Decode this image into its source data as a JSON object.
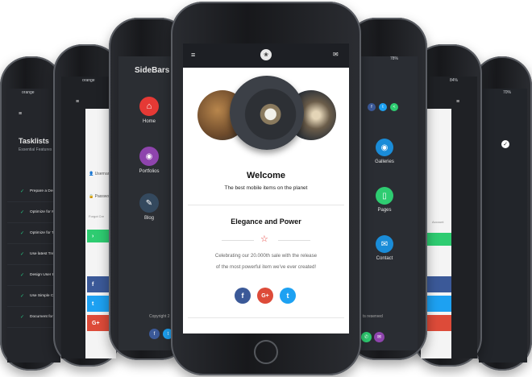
{
  "phone_far_left": {
    "carrier": "orange",
    "title": "Tasklists",
    "subtitle": "Essential Features Sh",
    "tasks": [
      "Prepare a Design",
      "Optimize for Mo",
      "Optimize for Ta",
      "Use latest Trend",
      "Design User Exp",
      "Use Simple Cod",
      "Document for El"
    ]
  },
  "phone_left2": {
    "carrier": "orange",
    "fields": [
      "Usernar",
      "Passwo",
      "Forgot Cre"
    ],
    "go_label": "›",
    "social": [
      "f",
      "t",
      "G+"
    ]
  },
  "phone_left1": {
    "title": "SideBars",
    "nav": [
      {
        "label": "Home",
        "icon": "home-icon",
        "color": "#e53935"
      },
      {
        "label": "Portfolios",
        "icon": "camera-icon",
        "color": "#8e44ad"
      },
      {
        "label": "Blog",
        "icon": "pencil-icon",
        "color": "#34495e"
      }
    ],
    "copyright": "Copyright 2",
    "social": [
      "f",
      "t"
    ]
  },
  "phone_center": {
    "menu_icon": "hamburger-icon",
    "logo_icon": "logo-icon",
    "mail_icon": "mail-icon",
    "welcome_title": "Welcome",
    "welcome_subtitle": "The best mobile items on the planet",
    "section_title": "Elegance and Power",
    "star_icon": "star-icon",
    "body_line1": "Celebrating our 20.000th sale with the release",
    "body_line2": "of the most powerful item we've ever created!",
    "social": [
      {
        "label": "f",
        "icon": "facebook-icon",
        "color": "#3b5998"
      },
      {
        "label": "G+",
        "icon": "google-plus-icon",
        "color": "#dd4b39"
      },
      {
        "label": "t",
        "icon": "twitter-icon",
        "color": "#1da1f2"
      }
    ]
  },
  "phone_right1": {
    "battery": "78%",
    "nav": [
      {
        "label": "Galleries",
        "icon": "camera-icon"
      },
      {
        "label": "Pages",
        "icon": "page-icon"
      },
      {
        "label": "Contact",
        "icon": "mail-icon"
      }
    ],
    "footer": "ts reserved",
    "top_social": [
      "f",
      "t",
      "<"
    ]
  },
  "phone_right2": {
    "battery": "84%",
    "account": "Account",
    "bars": [
      "#2ecc71",
      "#3b5998",
      "#1da1f2",
      "#dd4b39"
    ]
  },
  "phone_far_right": {
    "battery": "70%"
  }
}
